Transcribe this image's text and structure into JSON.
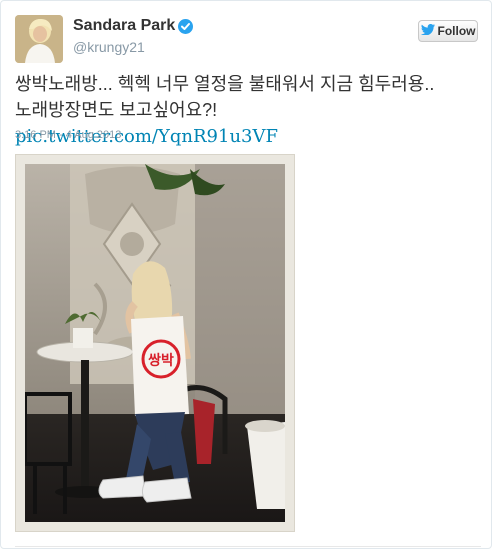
{
  "user": {
    "display_name": "Sandara Park",
    "handle": "@krungy21",
    "verified": true
  },
  "follow_button": {
    "label": "Follow",
    "icon": "twitter-bird-icon"
  },
  "tweet": {
    "line1": "쌍박노래방... 헥헥 너무 열정을 불태워서 지금 힘두러용..",
    "line2": "노래방장면도 보고싶어요?! ",
    "link": "pic.twitter.com/YqnR91u3VF",
    "timestamp": "3:16 PM - 4 Aug 2013"
  },
  "photo": {
    "shirt_text": "쌍박"
  },
  "colors": {
    "link": "#0084b4",
    "verified": "#2aa3ef",
    "muted": "#8899a6",
    "shirt_logo": "#d8202a"
  }
}
